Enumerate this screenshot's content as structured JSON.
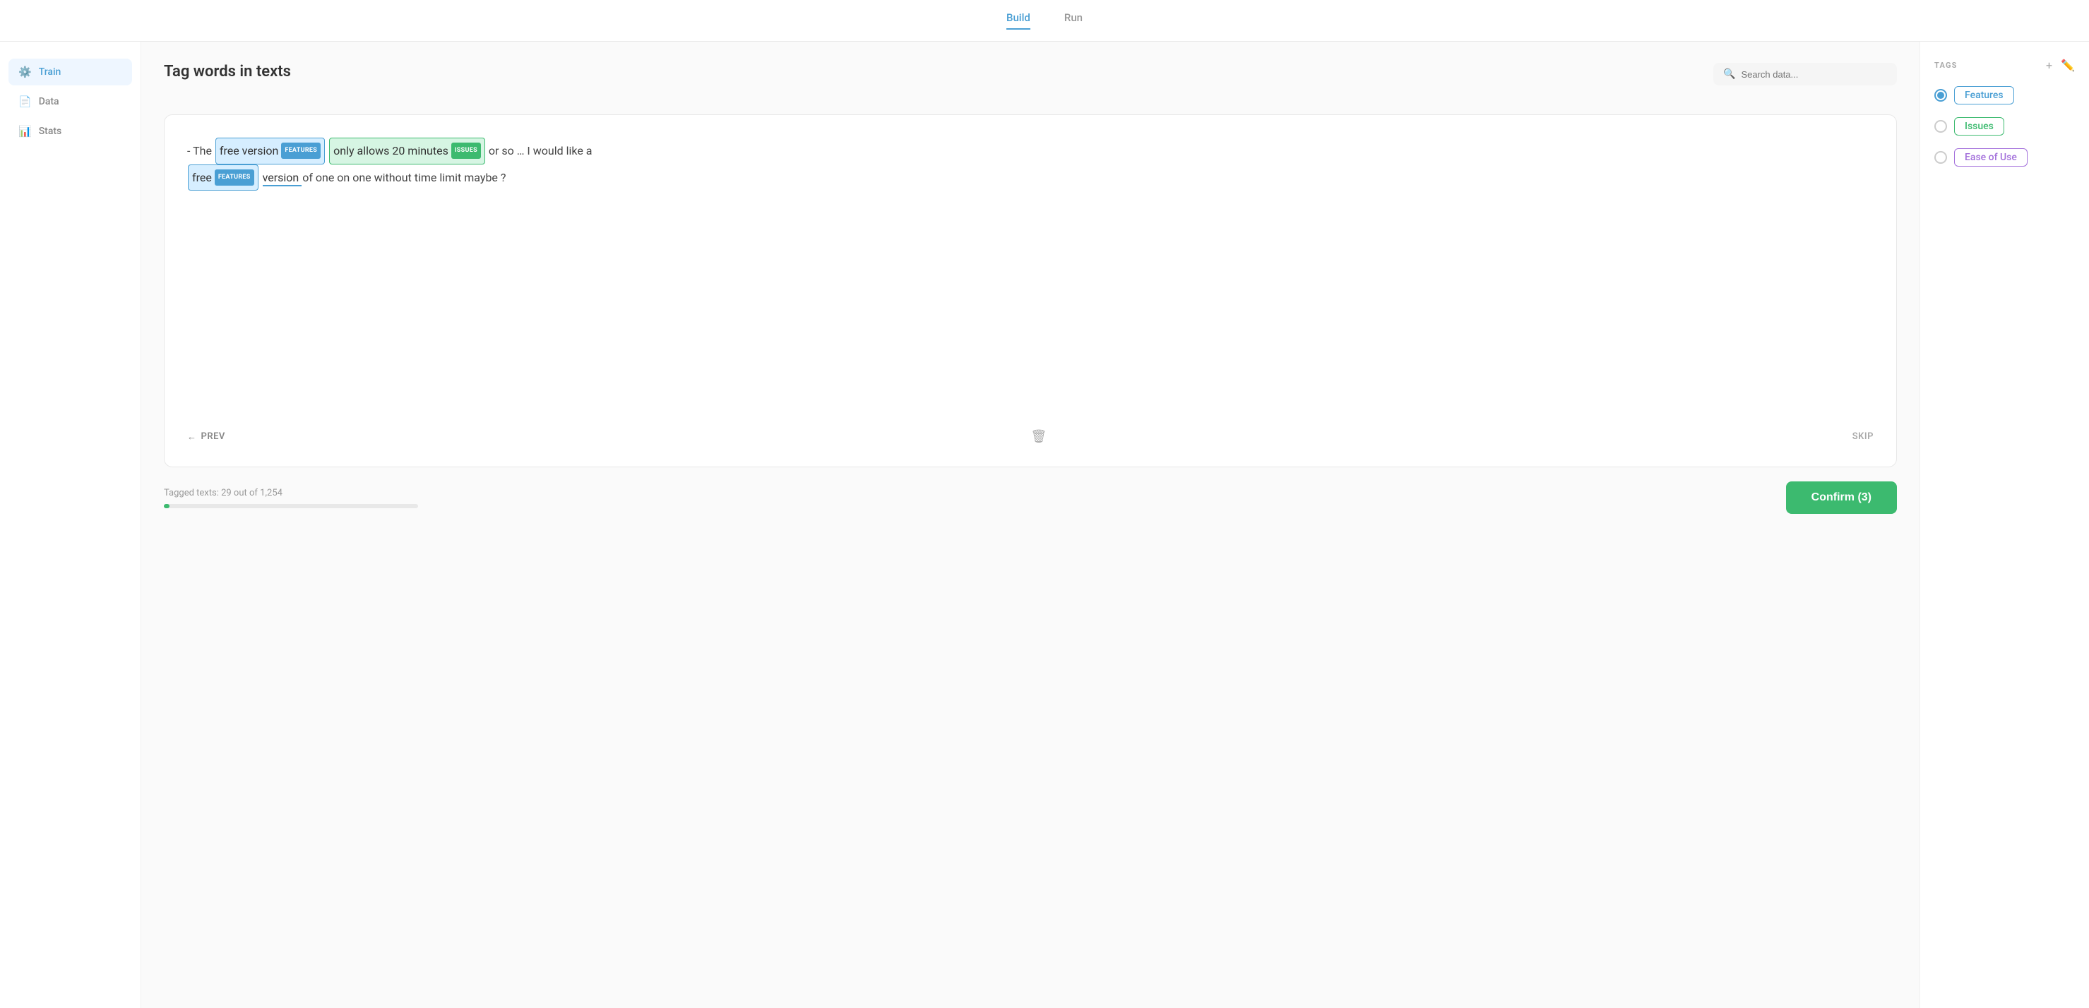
{
  "nav": {
    "tabs": [
      {
        "id": "build",
        "label": "Build",
        "active": true
      },
      {
        "id": "run",
        "label": "Run",
        "active": false
      }
    ]
  },
  "sidebar": {
    "items": [
      {
        "id": "train",
        "label": "Train",
        "icon": "⚙️",
        "active": true
      },
      {
        "id": "data",
        "label": "Data",
        "icon": "📄",
        "active": false
      },
      {
        "id": "stats",
        "label": "Stats",
        "icon": "📊",
        "active": false
      }
    ]
  },
  "main": {
    "page_title": "Tag words in texts",
    "search_placeholder": "Search data...",
    "card": {
      "text_prefix": "- The",
      "text_mid1": "or so … I would like a",
      "text_suffix": "version of one on one without time limit maybe ?",
      "segment1": "free version",
      "badge1": "FEATURES",
      "segment2": "only allows 20 minutes",
      "badge2": "ISSUES",
      "segment3": "free",
      "badge3": "FEATURES",
      "segment4": "version"
    },
    "footer": {
      "prev_label": "PREV",
      "skip_label": "SKIP"
    },
    "progress": {
      "label": "Tagged texts:",
      "current": 29,
      "total": "1,254",
      "label_text": "Tagged texts: 29 out of 1,254",
      "percent": 2.3
    },
    "confirm_button": "Confirm  (3)"
  },
  "tags_panel": {
    "title": "TAGS",
    "tags": [
      {
        "id": "features",
        "label": "Features",
        "color": "blue",
        "selected": true
      },
      {
        "id": "issues",
        "label": "Issues",
        "color": "green",
        "selected": false
      },
      {
        "id": "ease-of-use",
        "label": "Ease of Use",
        "color": "purple",
        "selected": false
      }
    ]
  }
}
